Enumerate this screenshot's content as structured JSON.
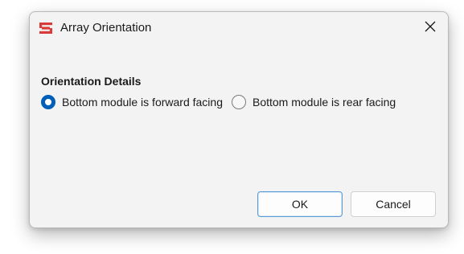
{
  "window": {
    "title": "Array Orientation",
    "icon": "app-logo-icon",
    "accent_color": "#005fb8",
    "logo_color": "#d83b3b"
  },
  "orientation": {
    "heading": "Orientation Details",
    "options": [
      {
        "label": "Bottom module is forward facing",
        "selected": true
      },
      {
        "label": "Bottom module is rear facing",
        "selected": false
      }
    ]
  },
  "buttons": {
    "ok_label": "OK",
    "cancel_label": "Cancel"
  }
}
